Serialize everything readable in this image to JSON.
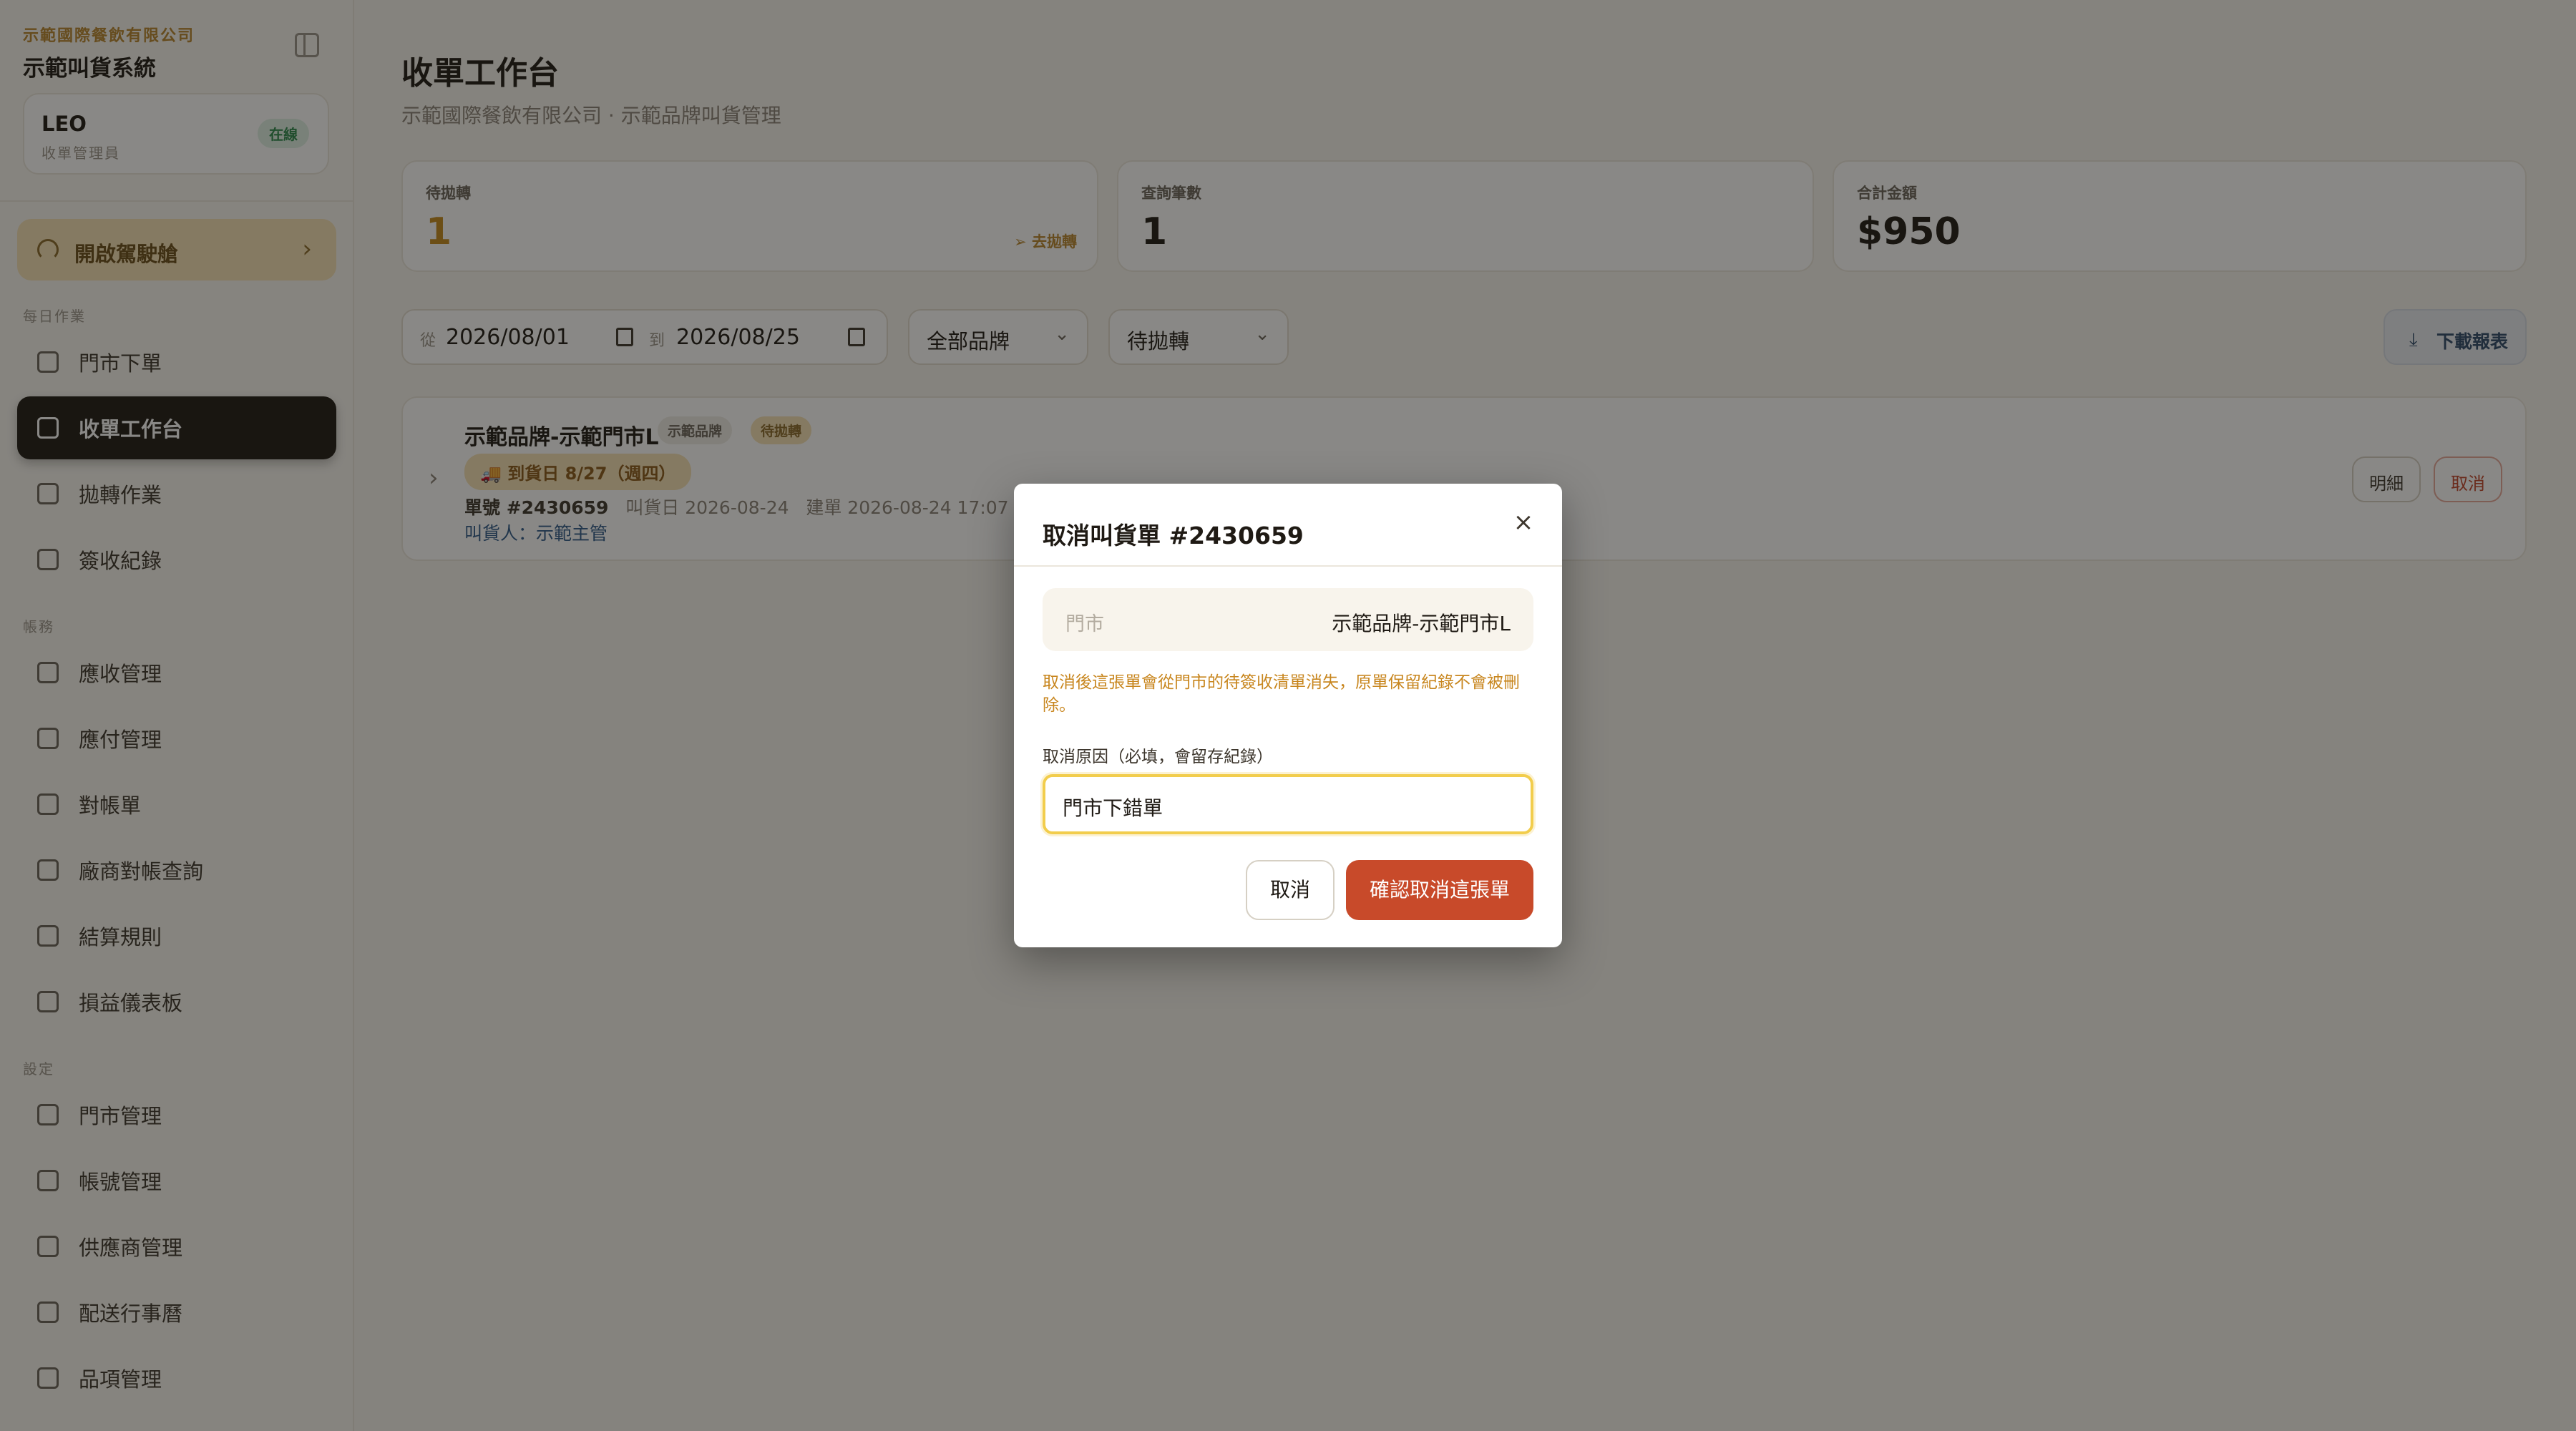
{
  "sidebar": {
    "org_name": "示範國際餐飲有限公司",
    "system_name": "示範叫貨系統",
    "user": {
      "name": "LEO",
      "role": "收單管理員",
      "status": "在線"
    },
    "driver_button": "開啟駕駛艙",
    "sections": [
      {
        "label": "每日作業",
        "items": [
          "門市下單",
          "收單工作台",
          "拋轉作業",
          "簽收紀錄"
        ]
      },
      {
        "label": "帳務",
        "items": [
          "應收管理",
          "應付管理",
          "對帳單",
          "廠商對帳查詢",
          "結算規則",
          "損益儀表板"
        ]
      },
      {
        "label": "設定",
        "items": [
          "門市管理",
          "帳號管理",
          "供應商管理",
          "配送行事曆",
          "品項管理"
        ]
      }
    ],
    "active_item": "收單工作台"
  },
  "main": {
    "title": "收單工作台",
    "subtitle": "示範國際餐飲有限公司 · 示範品牌叫貨管理",
    "stats": [
      {
        "label": "待拋轉",
        "value": "1",
        "link": "去拋轉"
      },
      {
        "label": "查詢筆數",
        "value": "1"
      },
      {
        "label": "合計金額",
        "value": "$950"
      }
    ],
    "filters": {
      "from_label": "從",
      "from_date": "2026/08/01",
      "to_label": "到",
      "to_date": "2026/08/25",
      "brand": "全部品牌",
      "status": "待拋轉"
    },
    "download_label": "下載報表",
    "order": {
      "store": "示範品牌-示範門市L",
      "brand_tag": "示範品牌",
      "status_tag": "待拋轉",
      "delivery": "🚚 到貨日 8/27（週四）",
      "number": "單號 #2430659",
      "order_date": "叫貨日 2026-08-24",
      "created": "建單 2026-08-24 17:07",
      "amount_fragment": "$",
      "orderer": "叫貨人：示範主管",
      "detail_button": "明細",
      "cancel_button": "取消"
    }
  },
  "modal": {
    "title": "取消叫貨單 #2430659",
    "store_label": "門市",
    "store_value": "示範品牌-示範門市L",
    "warning": "取消後這張單會從門市的待簽收清單消失，原單保留紀錄不會被刪除。",
    "reason_label": "取消原因（必填，會留存紀錄）",
    "reason_value": "門市下錯單",
    "cancel_button": "取消",
    "confirm_button": "確認取消這張單"
  }
}
